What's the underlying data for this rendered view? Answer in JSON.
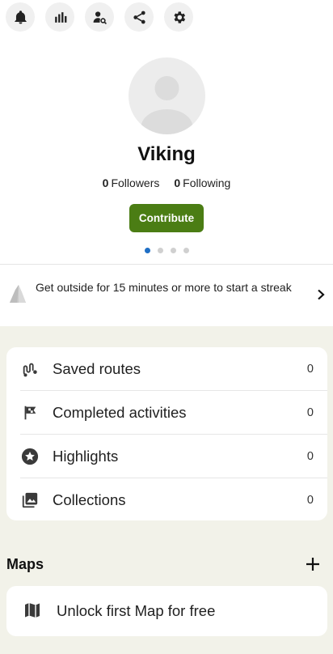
{
  "toolbar": {
    "icons": [
      "bell-icon",
      "stats-icon",
      "find-person-icon",
      "share-icon",
      "settings-icon"
    ]
  },
  "profile": {
    "name": "Viking",
    "followers_count": "0",
    "followers_label": "Followers",
    "following_count": "0",
    "following_label": "Following",
    "contribute_label": "Contribute",
    "carousel_pages": 4,
    "carousel_active": 1
  },
  "streak": {
    "text": "Get outside for 15 minutes or more to start a streak"
  },
  "lists": [
    {
      "label": "Saved routes",
      "count": "0",
      "icon": "route-icon"
    },
    {
      "label": "Completed activities",
      "count": "0",
      "icon": "flag-icon"
    },
    {
      "label": "Highlights",
      "count": "0",
      "icon": "star-icon"
    },
    {
      "label": "Collections",
      "count": "0",
      "icon": "collection-icon"
    }
  ],
  "maps": {
    "title": "Maps",
    "unlock_label": "Unlock first Map for free"
  },
  "colors": {
    "accent_green": "#4b7d14",
    "active_dot": "#1f6fc5",
    "section_bg": "#f2f2e9"
  }
}
